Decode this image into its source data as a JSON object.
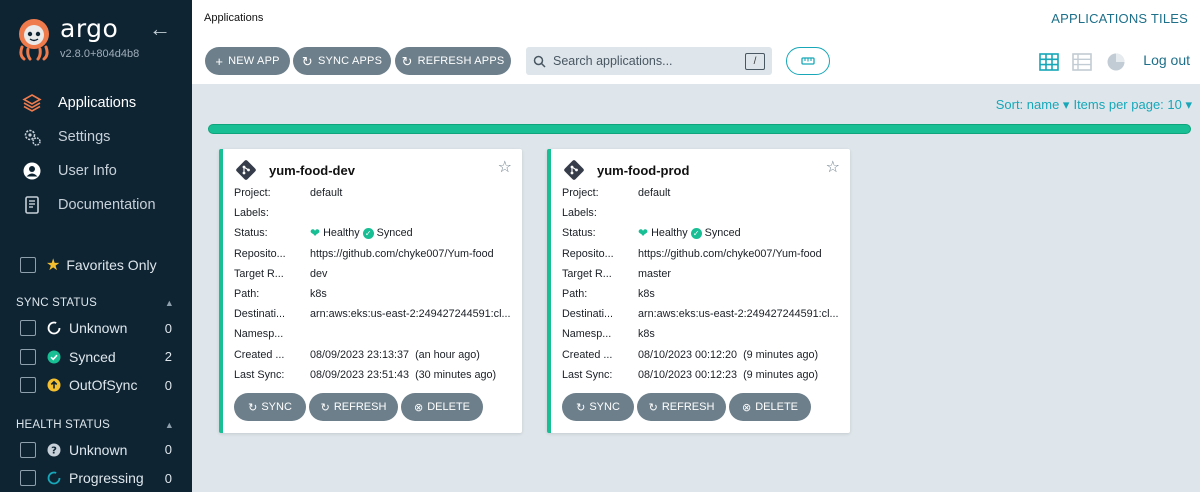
{
  "brand": {
    "name": "argo",
    "version": "v2.8.0+804d4b8"
  },
  "sidebar": {
    "nav": [
      {
        "label": "Applications",
        "icon": "layers-icon"
      },
      {
        "label": "Settings",
        "icon": "gears-icon"
      },
      {
        "label": "User Info",
        "icon": "user-circle-icon"
      },
      {
        "label": "Documentation",
        "icon": "book-icon"
      }
    ],
    "favorites_label": "Favorites Only",
    "sync_status": {
      "title": "SYNC STATUS",
      "items": [
        {
          "label": "Unknown",
          "count": "0"
        },
        {
          "label": "Synced",
          "count": "2"
        },
        {
          "label": "OutOfSync",
          "count": "0"
        }
      ]
    },
    "health_status": {
      "title": "HEALTH STATUS",
      "items": [
        {
          "label": "Unknown",
          "count": "0"
        },
        {
          "label": "Progressing",
          "count": "0"
        }
      ]
    }
  },
  "header": {
    "breadcrumb": "Applications",
    "view_title": "APPLICATIONS TILES",
    "new_app": "NEW APP",
    "sync_apps": "SYNC APPS",
    "refresh_apps": "REFRESH APPS",
    "search_placeholder": "Search applications...",
    "search_key": "/",
    "logout": "Log out"
  },
  "list": {
    "sort_label": "Sort: name",
    "per_page_label": "Items per page: 10"
  },
  "colors": {
    "accent": "#17a7b8",
    "healthy": "#18be94",
    "sidebar": "#0e2433",
    "button": "#6d7f8b"
  },
  "cards": [
    {
      "name": "yum-food-dev",
      "rows": [
        {
          "key": "Project:",
          "value": "default"
        },
        {
          "key": "Labels:",
          "value": ""
        },
        {
          "key": "Status:",
          "value": ""
        },
        {
          "key": "Reposito...",
          "value": "https://github.com/chyke007/Yum-food"
        },
        {
          "key": "Target R...",
          "value": "dev"
        },
        {
          "key": "Path:",
          "value": "k8s"
        },
        {
          "key": "Destinati...",
          "value": "arn:aws:eks:us-east-2:249427244591:cl..."
        },
        {
          "key": "Namesp...",
          "value": ""
        },
        {
          "key": "Created ...",
          "value": "08/09/2023 23:13:37  (an hour ago)"
        },
        {
          "key": "Last Sync:",
          "value": "08/09/2023 23:51:43  (30 minutes ago)"
        }
      ],
      "health": "Healthy",
      "sync": "Synced",
      "actions": {
        "sync": "SYNC",
        "refresh": "REFRESH",
        "delete": "DELETE"
      }
    },
    {
      "name": "yum-food-prod",
      "rows": [
        {
          "key": "Project:",
          "value": "default"
        },
        {
          "key": "Labels:",
          "value": ""
        },
        {
          "key": "Status:",
          "value": ""
        },
        {
          "key": "Reposito...",
          "value": "https://github.com/chyke007/Yum-food"
        },
        {
          "key": "Target R...",
          "value": "master"
        },
        {
          "key": "Path:",
          "value": "k8s"
        },
        {
          "key": "Destinati...",
          "value": "arn:aws:eks:us-east-2:249427244591:cl..."
        },
        {
          "key": "Namesp...",
          "value": "k8s"
        },
        {
          "key": "Created ...",
          "value": "08/10/2023 00:12:20  (9 minutes ago)"
        },
        {
          "key": "Last Sync:",
          "value": "08/10/2023 00:12:23  (9 minutes ago)"
        }
      ],
      "health": "Healthy",
      "sync": "Synced",
      "actions": {
        "sync": "SYNC",
        "refresh": "REFRESH",
        "delete": "DELETE"
      }
    }
  ]
}
